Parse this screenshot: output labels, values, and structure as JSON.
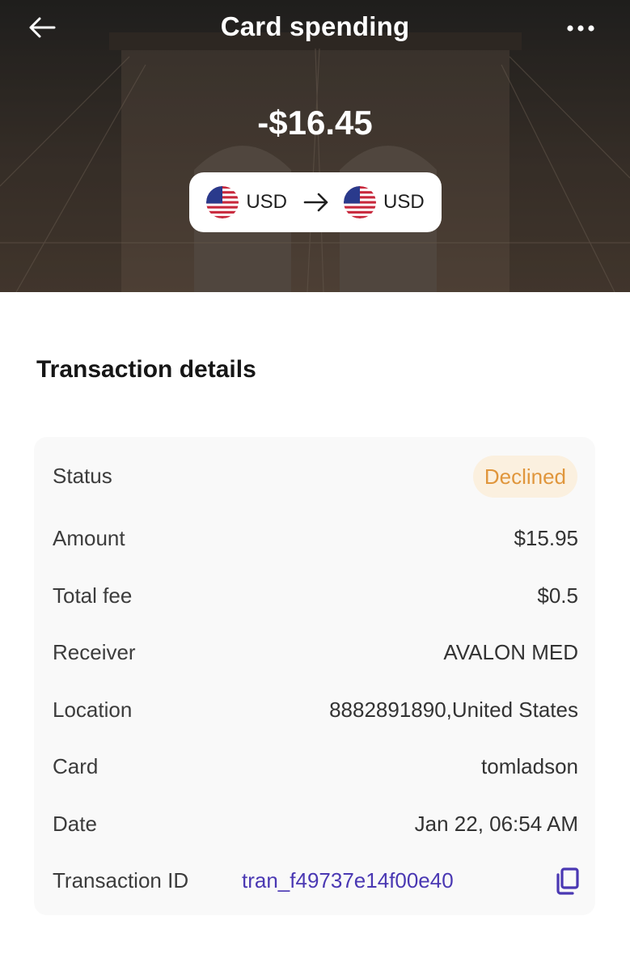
{
  "header": {
    "title": "Card spending",
    "back_icon": "arrow-left-icon",
    "more_icon": "more-horizontal-icon"
  },
  "hero": {
    "amount": "-$16.45",
    "from_currency": "USD",
    "to_currency": "USD",
    "from_flag": "us-flag-icon",
    "to_flag": "us-flag-icon",
    "arrow_icon": "arrow-right-icon"
  },
  "details": {
    "title": "Transaction details",
    "status_label": "Status",
    "status_value": "Declined",
    "amount_label": "Amount",
    "amount_value": "$15.95",
    "fee_label": "Total fee",
    "fee_value": "$0.5",
    "receiver_label": "Receiver",
    "receiver_value": "AVALON MED",
    "location_label": "Location",
    "location_value": "8882891890,United States",
    "card_label": "Card",
    "card_value": "tomladson",
    "date_label": "Date",
    "date_value": "Jan 22, 06:54 AM",
    "txid_label": "Transaction ID",
    "txid_value": "tran_f49737e14f00e40",
    "copy_icon": "copy-icon"
  },
  "colors": {
    "status_declined_text": "#e0963c",
    "status_declined_bg": "#fbf0df",
    "link": "#4a38b3",
    "card_bg": "#f9f9f9"
  }
}
